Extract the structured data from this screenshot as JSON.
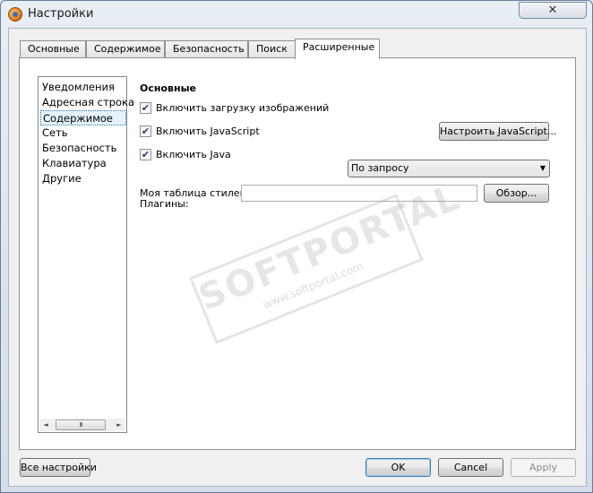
{
  "window": {
    "title": "Настройки",
    "close_label": "✕"
  },
  "tabs": [
    {
      "label": "Основные",
      "active": false
    },
    {
      "label": "Содержимое",
      "active": false
    },
    {
      "label": "Безопасность",
      "active": false
    },
    {
      "label": "Поиск",
      "active": false
    },
    {
      "label": "Расширенные",
      "active": true
    }
  ],
  "sidebar": {
    "items": [
      {
        "label": "Уведомления",
        "selected": false
      },
      {
        "label": "Адресная строка",
        "selected": false
      },
      {
        "label": "Содержимое",
        "selected": true
      },
      {
        "label": "Сеть",
        "selected": false
      },
      {
        "label": "Безопасность",
        "selected": false
      },
      {
        "label": "Клавиатура",
        "selected": false
      },
      {
        "label": "Другие",
        "selected": false
      }
    ],
    "scroll_left": "◄",
    "scroll_right": "►",
    "scroll_grip": "III"
  },
  "content": {
    "section_title": "Основные",
    "checkboxes": [
      {
        "label": "Включить загрузку изображений",
        "checked": true
      },
      {
        "label": "Включить JavaScript",
        "checked": true
      },
      {
        "label": "Включить Java",
        "checked": true
      }
    ],
    "check_mark": "✔",
    "js_button_label": "Настроить JavaScript...",
    "plugins_label": "Плагины:",
    "plugins_value": "По запросу",
    "combo_arrow": "▼",
    "stylesheet_label": "Моя таблица стилей:",
    "stylesheet_value": "",
    "browse_button_label": "Обзор..."
  },
  "footer": {
    "all_settings_label": "Все настройки",
    "ok_label": "OK",
    "cancel_label": "Cancel",
    "apply_label": "Apply"
  },
  "watermark": {
    "main": "SOFTPORTAL",
    "sub": "www.softportal.com"
  },
  "colors": {
    "accent": "#3c7fb1",
    "selection_bg": "#e5f1fb"
  }
}
